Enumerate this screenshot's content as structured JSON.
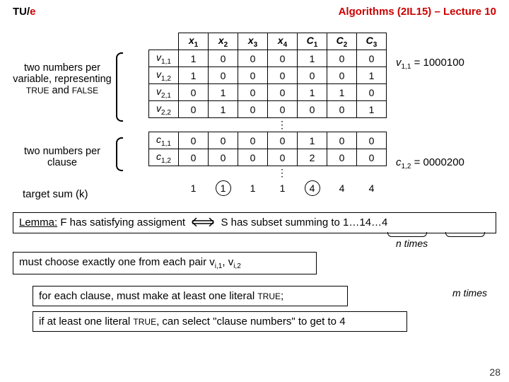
{
  "header": {
    "inst_pre": "TU",
    "inst_slash": "/",
    "inst_e": "e",
    "course": "Algorithms (2IL15) – Lecture 10"
  },
  "table": {
    "cols": [
      "x1",
      "x2",
      "x3",
      "x4",
      "C1",
      "C2",
      "C3"
    ],
    "rows": [
      {
        "label": "v1,1",
        "cells": [
          "1",
          "0",
          "0",
          "0",
          "1",
          "0",
          "0"
        ]
      },
      {
        "label": "v1,2",
        "cells": [
          "1",
          "0",
          "0",
          "0",
          "0",
          "0",
          "1"
        ]
      },
      {
        "label": "v2,1",
        "cells": [
          "0",
          "1",
          "0",
          "0",
          "1",
          "1",
          "0"
        ]
      },
      {
        "label": "v2,2",
        "cells": [
          "0",
          "1",
          "0",
          "0",
          "0",
          "0",
          "1"
        ]
      },
      {
        "label": "c1,1",
        "cells": [
          "0",
          "0",
          "0",
          "0",
          "1",
          "0",
          "0"
        ]
      },
      {
        "label": "c1,2",
        "cells": [
          "0",
          "0",
          "0",
          "0",
          "2",
          "0",
          "0"
        ]
      }
    ],
    "target": [
      "1",
      "1",
      "1",
      "1",
      "4",
      "4",
      "4"
    ]
  },
  "notes": {
    "left1a": "two numbers per variable, representing",
    "left1b": "TRUE",
    "left1c": " and ",
    "left1d": "FALSE",
    "left2": "two numbers per clause",
    "target": "target sum (k)",
    "annot1_lhs": "v",
    "annot1_sub": "1,1",
    "annot1_eq": " = 1000100",
    "annot2_lhs": "c",
    "annot2_sub": "1,2",
    "annot2_eq": " = 0000200"
  },
  "lemma": {
    "label": "Lemma:",
    "left": " F has satisfying assigment ",
    "right": " S has subset summing to  1…14…4"
  },
  "boxes": {
    "must_a": "must choose exactly one from each pair  v",
    "must_s1": "i,1",
    "must_b": ", v",
    "must_s2": "i,2",
    "each1_a": "for each clause, must make at least one literal ",
    "each1_b": "TRUE",
    "each1_c": ";",
    "each2_a": "if at least one literal ",
    "each2_b": "TRUE",
    "each2_c": ", can select \"clause numbers\" to get to 4"
  },
  "times": {
    "n": "n times",
    "m": "m times"
  },
  "slide": "28"
}
